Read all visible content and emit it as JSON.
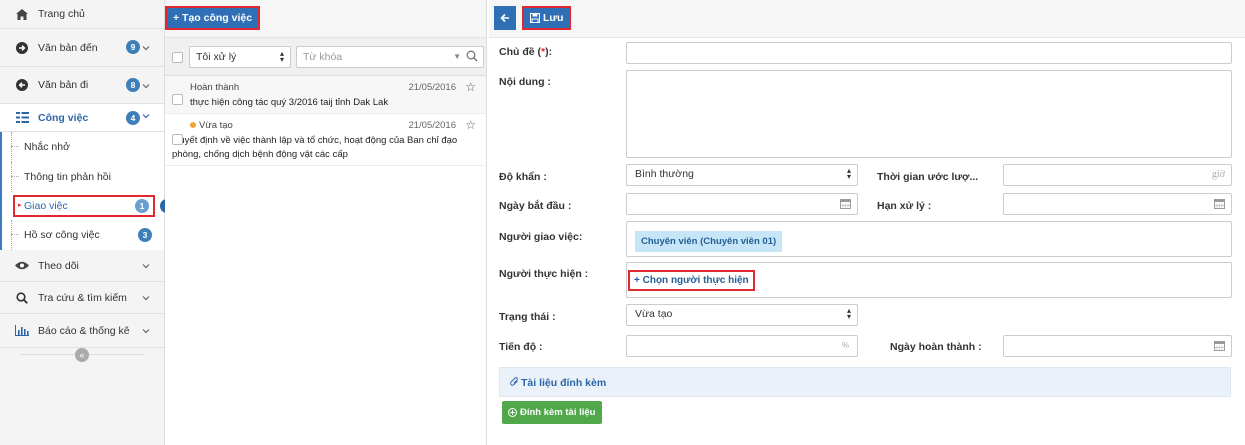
{
  "sidebar": {
    "home": "Trang chủ",
    "incoming_docs": {
      "label": "Văn bản đến",
      "count": "9"
    },
    "outgoing_docs": {
      "label": "Văn bản đi",
      "count": "8"
    },
    "tasks": {
      "label": "Công việc",
      "count": "4"
    },
    "sub_items": [
      {
        "label": "Nhắc nhở"
      },
      {
        "label": "Thông tin phản hồi"
      },
      {
        "label": "Giao việc",
        "count": "1"
      },
      {
        "label": "Hồ sơ công việc",
        "count": "3"
      }
    ],
    "tracking": "Theo dõi",
    "lookup": "Tra cứu & tìm kiếm",
    "reports": "Báo cáo & thống kê"
  },
  "middle": {
    "create_label": "+ Tạo công việc",
    "filter_value": "Tôi xử lý",
    "search_placeholder": "Từ khóa",
    "tasks": [
      {
        "status": "Hoàn thành",
        "date": "21/05/2016",
        "title": "thực hiện công tác quý 3/2016 taij tỉnh Dak Lak"
      },
      {
        "status": "Vừa tạo",
        "date": "21/05/2016",
        "title": "Quyết định về việc thành lập và tổ chức, hoạt động của Ban chỉ đạo phòng, chống dịch bệnh động vật các cấp"
      }
    ]
  },
  "form": {
    "save_label": "Lưu",
    "subject_label": "Chủ đề (",
    "subject_req": "*",
    "subject_label_end": "):",
    "content_label": "Nội dung :",
    "urgency_label": "Độ khẩn :",
    "urgency_value": "Bình thường",
    "est_time_label": "Thời gian ước lượ...",
    "est_time_suffix": "giờ",
    "start_date_label": "Ngày bắt đầu :",
    "deadline_label": "Hạn xử lý :",
    "assigner_label": "Người giao việc:",
    "assigner_value": "Chuyên viên (Chuyên viên 01)",
    "performer_label": "Người thực hiện :",
    "performer_link": "+ Chọn người thực hiện",
    "status_label": "Trạng thái :",
    "status_value": "Vừa tạo",
    "progress_label": "Tiến độ :",
    "progress_suffix": "%",
    "completion_date_label": "Ngày hoàn thành :",
    "attachments_title": "Tài liệu đính kèm",
    "attach_button": "Đính kèm tài liệu"
  }
}
